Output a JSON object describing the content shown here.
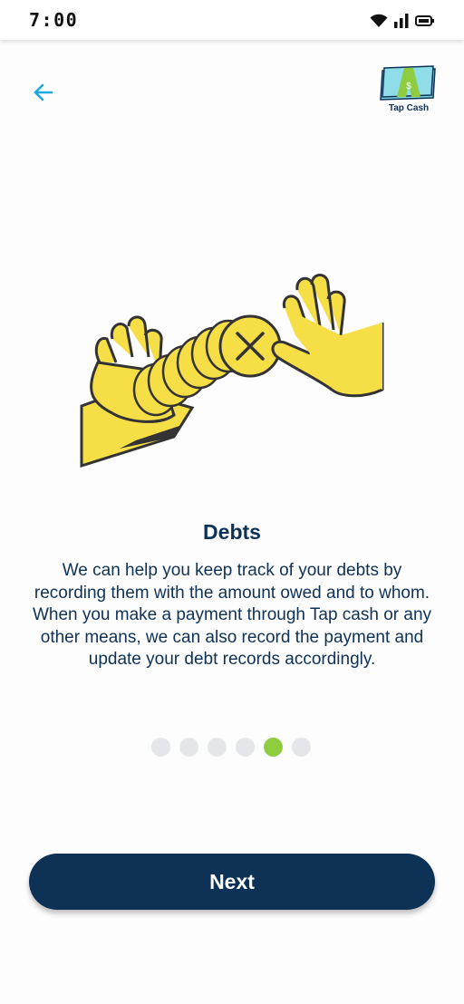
{
  "status_bar": {
    "time": "7:00",
    "icons": [
      "wifi-icon",
      "signal-icon",
      "battery-icon"
    ]
  },
  "header": {
    "back_icon": "arrow-left-icon",
    "logo_text": "Tap Cash"
  },
  "illustration": {
    "subject": "hands-passing-coins"
  },
  "content": {
    "title": "Debts",
    "description": "We can help you keep track of your debts by recording them with the amount owed and to whom. When you make a payment through Tap cash or any other means, we can also record the payment and update your debt records accordingly."
  },
  "pagination": {
    "total": 6,
    "active_index": 4
  },
  "footer": {
    "next_label": "Next"
  },
  "colors": {
    "primary": "#0e3156",
    "accent": "#8fcc3f",
    "back_arrow": "#1ea7e1",
    "illustration_yellow": "#f5de46",
    "dot_inactive": "#e4e6ea"
  }
}
